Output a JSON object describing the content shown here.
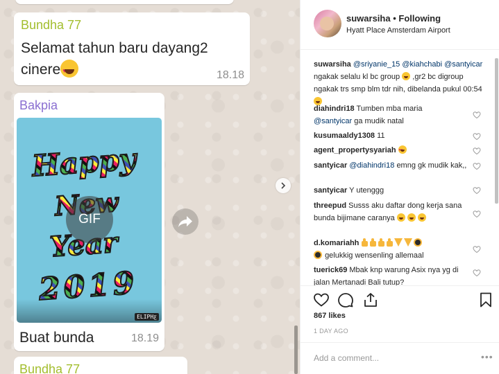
{
  "chat": {
    "msg1": {
      "sender": "Bundha 77",
      "text": "Selamat tahun baru dayang2 cinere",
      "time": "18.18",
      "sender_color": "#a3be2e"
    },
    "msg2": {
      "sender": "Bakpia",
      "sender_color": "#8a6fd1",
      "gif_words": [
        "Happy",
        "New",
        "Year",
        "2019"
      ],
      "gif_badge": "GIF",
      "gif_watermark": "ELIPHƹ",
      "caption": "Buat bunda",
      "time": "18.19"
    },
    "msg3": {
      "sender": "Bundha 77"
    }
  },
  "post": {
    "username": "suwarsiha",
    "separator": "•",
    "follow_status": "Following",
    "location": "Hyatt Place Amsterdam Airport",
    "caption": {
      "user": "suwarsiha",
      "mentions": [
        "@sriyanie_15",
        "@kiahchabi",
        "@santyicar"
      ],
      "text": "ngakak selalu kl bc group",
      "text2": ",gr2 bc digroup ngakak trs smp blm tdr nih, dibelanda pukul 00:54"
    },
    "comments": [
      {
        "user": "diahindri18",
        "text": "Tumben mba maria",
        "mention": "@santyicar",
        "text2": "ga mudik natal"
      },
      {
        "user": "kusumaaldy1308",
        "text": "11"
      },
      {
        "user": "agent_propertysyariah",
        "text": ""
      },
      {
        "user": "santyicar",
        "mention": "@diahindri18",
        "text": "emng gk mudik kak,,"
      },
      {
        "user": "santyicar",
        "text": "Y utenggg"
      },
      {
        "user": "threepud",
        "text": "Susss aku daftar dong kerja sana bunda bijimane caranya"
      },
      {
        "user": "d.komariahh",
        "text": "gelukkig wensenling allemaal"
      },
      {
        "user": "tuerick69",
        "text": "Mbak knp warung Asix nya yg di jalan Mertanadi Bali tutup?"
      }
    ],
    "likes": "867 likes",
    "age": "1 DAY AGO",
    "comment_placeholder": "Add a comment...",
    "more_label": "•••"
  }
}
